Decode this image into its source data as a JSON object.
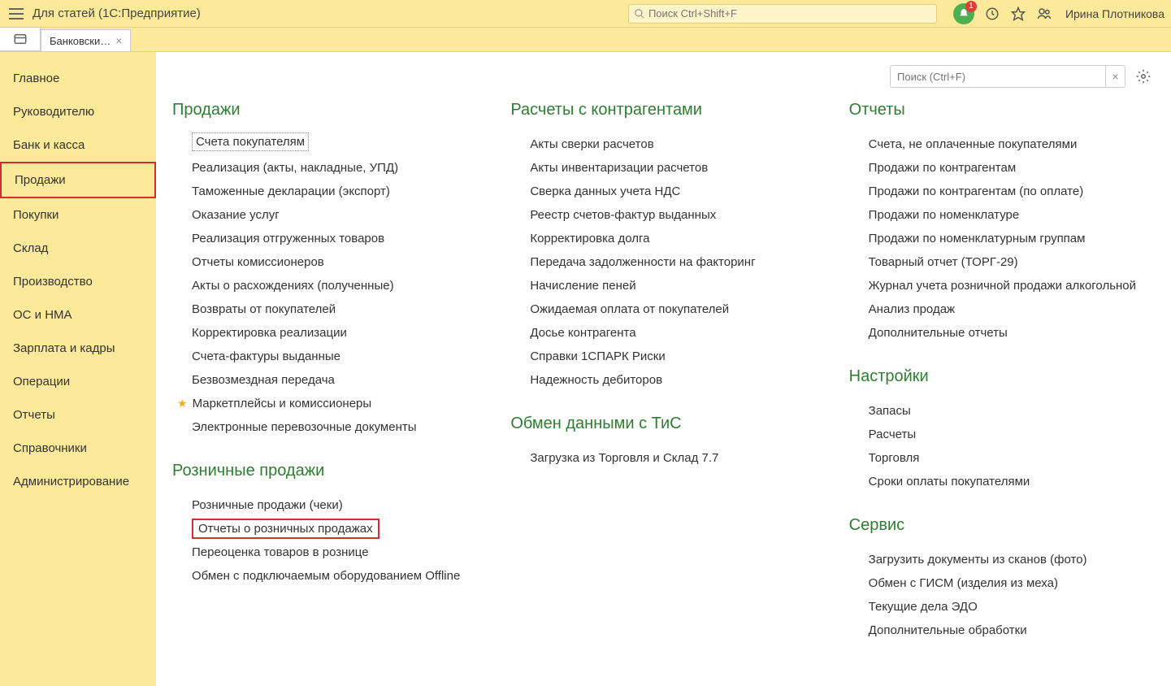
{
  "titlebar": {
    "title": "Для статей  (1С:Предприятие)",
    "search_placeholder": "Поиск Ctrl+Shift+F",
    "notification_count": "1",
    "user_name": "Ирина Плотникова"
  },
  "tabs": {
    "active_label": "Банковски…"
  },
  "sidebar": {
    "items": [
      "Главное",
      "Руководителю",
      "Банк и касса",
      "Продажи",
      "Покупки",
      "Склад",
      "Производство",
      "ОС и НМА",
      "Зарплата и кадры",
      "Операции",
      "Отчеты",
      "Справочники",
      "Администрирование"
    ],
    "active_index": 3
  },
  "content_search_placeholder": "Поиск (Ctrl+F)",
  "col1": {
    "section1_title": "Продажи",
    "section1_links": [
      "Счета покупателям",
      "Реализация (акты, накладные, УПД)",
      "Таможенные декларации (экспорт)",
      "Оказание услуг",
      "Реализация отгруженных товаров",
      "Отчеты комиссионеров",
      "Акты о расхождениях (полученные)",
      "Возвраты от покупателей",
      "Корректировка реализации",
      "Счета-фактуры выданные",
      "Безвозмездная передача",
      "Маркетплейсы и комиссионеры",
      "Электронные перевозочные документы"
    ],
    "section2_title": "Розничные продажи",
    "section2_links": [
      "Розничные продажи (чеки)",
      "Отчеты о розничных продажах",
      "Переоценка товаров в рознице",
      "Обмен с подключаемым оборудованием Offline"
    ]
  },
  "col2": {
    "section1_title": "Расчеты с контрагентами",
    "section1_links": [
      "Акты сверки расчетов",
      "Акты инвентаризации расчетов",
      "Сверка данных учета НДС",
      "Реестр счетов-фактур выданных",
      "Корректировка долга",
      "Передача задолженности на факторинг",
      "Начисление пеней",
      "Ожидаемая оплата от покупателей",
      "Досье контрагента",
      "Справки 1СПАРК Риски",
      "Надежность дебиторов"
    ],
    "section2_title": "Обмен данными с ТиС",
    "section2_links": [
      "Загрузка из Торговля и Склад 7.7"
    ]
  },
  "col3": {
    "section1_title": "Отчеты",
    "section1_links": [
      "Счета, не оплаченные покупателями",
      "Продажи по контрагентам",
      "Продажи по контрагентам (по оплате)",
      "Продажи по номенклатуре",
      "Продажи по номенклатурным группам",
      "Товарный отчет (ТОРГ-29)",
      "Журнал учета розничной продажи алкогольной",
      "Анализ продаж",
      "Дополнительные отчеты"
    ],
    "section2_title": "Настройки",
    "section2_links": [
      "Запасы",
      "Расчеты",
      "Торговля",
      "Сроки оплаты покупателями"
    ],
    "section3_title": "Сервис",
    "section3_links": [
      "Загрузить документы из сканов (фото)",
      "Обмен с ГИСМ (изделия из меха)",
      "Текущие дела ЭДО",
      "Дополнительные обработки"
    ]
  }
}
